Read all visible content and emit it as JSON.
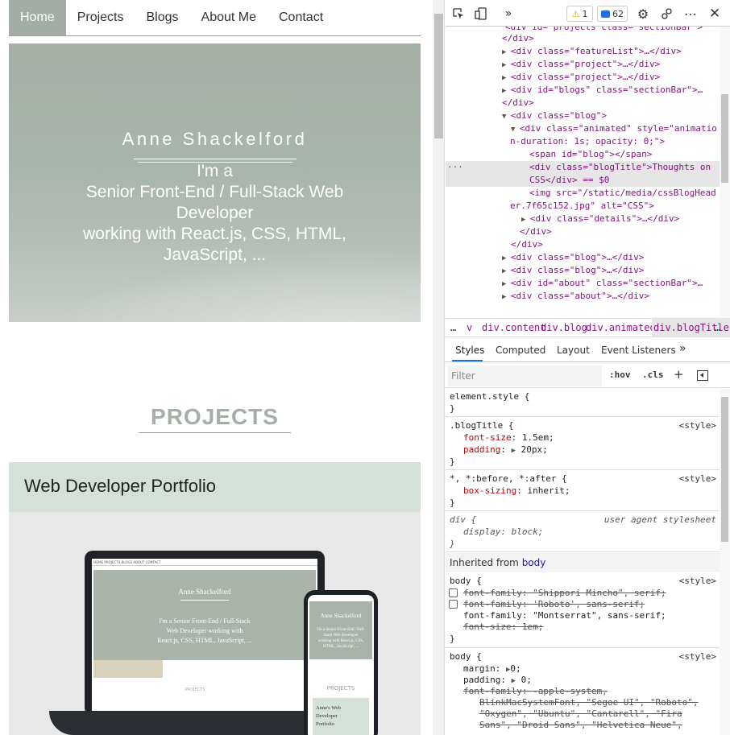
{
  "site": {
    "nav": [
      {
        "label": "Home",
        "active": true
      },
      {
        "label": "Projects"
      },
      {
        "label": "Blogs"
      },
      {
        "label": "About Me"
      },
      {
        "label": "Contact"
      }
    ],
    "hero": {
      "name": "Anne Shackelford",
      "tagline": [
        "I'm a",
        "Senior Front-End / Full-Stack Web",
        "Developer",
        "working with React.js, CSS, HTML,",
        "JavaScript, ..."
      ]
    },
    "projects_heading": "PROJECTS",
    "project_card": {
      "title": "Web Developer Portfolio",
      "mockup": {
        "laptop_nav": "HOME     PROJECTS     BLOGS     ABOUT     CONTACT",
        "laptop_name": "Anne Shackelford",
        "laptop_tagline": [
          "I'm a Senior Front-End / Full-Stack",
          "Web Developer working with",
          "React.js, CSS, HTML, JavaScript, ..."
        ],
        "laptop_projects": "PROJECTS",
        "phone_name": "Anne Shackelford",
        "phone_tagline": [
          "I'm a Senior Front-End / Full-",
          "Stack Web Developer",
          "working with React.js, CSS,",
          "HTML, JavaScript, ..."
        ],
        "phone_projects": "PROJECTS",
        "phone_card_title": [
          "Anne's Web",
          "Developer",
          "Portfolio"
        ]
      }
    },
    "colors": {
      "hero_bg": "#a9b3aa",
      "accent_green": "#d5e1d8",
      "heading_grey": "#a5aea7"
    }
  },
  "devtools": {
    "toolbar": {
      "inspect_icon": "inspect-element-icon",
      "device_icon": "device-toolbar-icon",
      "more_tabs": "»",
      "warnings": "1",
      "messages": "62",
      "settings_icon": "⚙",
      "kebab": "⋯",
      "close": "✕"
    },
    "dom": [
      {
        "pre": "  ",
        "tag": "div id= projects  class= sectionBar >",
        "raw": "<div id= projects  class= sectionBar >"
      },
      {
        "raw": "</div>"
      },
      {
        "raw": "<div class=\"featureList\">…</div>"
      },
      {
        "raw": "<div class=\"project\">…</div>"
      },
      {
        "raw": "<div class=\"project\">…</div>"
      },
      {
        "raw": "<div id=\"blogs\" class=\"sectionBar\">…"
      },
      {
        "raw": "</div>"
      },
      {
        "raw": "<div class=\"blog\">"
      },
      {
        "raw": "<div class=\"animated\" style=\"animatio"
      },
      {
        "raw": "n-duration: 1s; opacity: 0;\">"
      },
      {
        "raw": "<span id=\"blog\"></span>"
      },
      {
        "raw": "<div class=\"blogTitle\">Thoughts on"
      },
      {
        "raw": "CSS</div> == $0"
      },
      {
        "raw": "<img src=\"/static/media/cssBlogHead"
      },
      {
        "raw": "er.7f65c152.jpg\" alt=\"CSS\">"
      },
      {
        "raw": "<div class=\"details\">…</div>"
      },
      {
        "raw": "</div>"
      },
      {
        "raw": "</div>"
      },
      {
        "raw": "<div class=\"blog\">…</div>"
      },
      {
        "raw": "<div class=\"blog\">…</div>"
      },
      {
        "raw": "<div id=\"about\" class=\"sectionBar\">…"
      },
      {
        "raw": "<div class=\"about\">…</div>"
      }
    ],
    "breadcrumbs": [
      "…",
      "v",
      "div.content",
      "div.blog",
      "div.animated",
      "div.blogTitle",
      "…"
    ],
    "tabs": [
      "Styles",
      "Computed",
      "Layout",
      "Event Listeners",
      "»"
    ],
    "filter_placeholder": "Filter",
    "hov": ":hov",
    "cls": ".cls",
    "plus": "+",
    "styles": {
      "element_style": "element.style {",
      "blogtitle_sel": ".blogTitle {",
      "src_style": "<style>",
      "blogtitle_fs_prop": "font-size",
      "blogtitle_fs_val": "1.5em;",
      "blogtitle_pad_prop": "padding",
      "blogtitle_pad_val": "20px;",
      "universal_sel": "*, *:before, *:after {",
      "universal_prop": "box-sizing",
      "universal_val": "inherit;",
      "div_sel": "div {",
      "ua_label": "user agent stylesheet",
      "div_prop": "display",
      "div_val": "block;",
      "inherited_label": "Inherited from",
      "inherited_link": "body",
      "body_sel": "body {",
      "body1_l1": "font-family: \"Shippori Mincho\", serif;",
      "body1_l2": "font-family: 'Roboto', sans-serif;",
      "body1_l3_prop": "font-family",
      "body1_l3_val": "\"Montserrat\", sans-serif;",
      "body1_l4": "font-size: 1em;",
      "body2_margin_prop": "margin",
      "body2_margin_val": "0;",
      "body2_pad_prop": "padding",
      "body2_pad_val": "0;",
      "body2_ff1": "font-family: -apple-system,",
      "body2_ff2": "BlinkMacSystemFont, \"Segoe UI\", \"Roboto\",",
      "body2_ff3": "\"Oxygen\", \"Ubuntu\", \"Cantarell\", \"Fira",
      "body2_ff4": "Sans\", \"Droid Sans\", \"Helvetica Neue\","
    }
  }
}
